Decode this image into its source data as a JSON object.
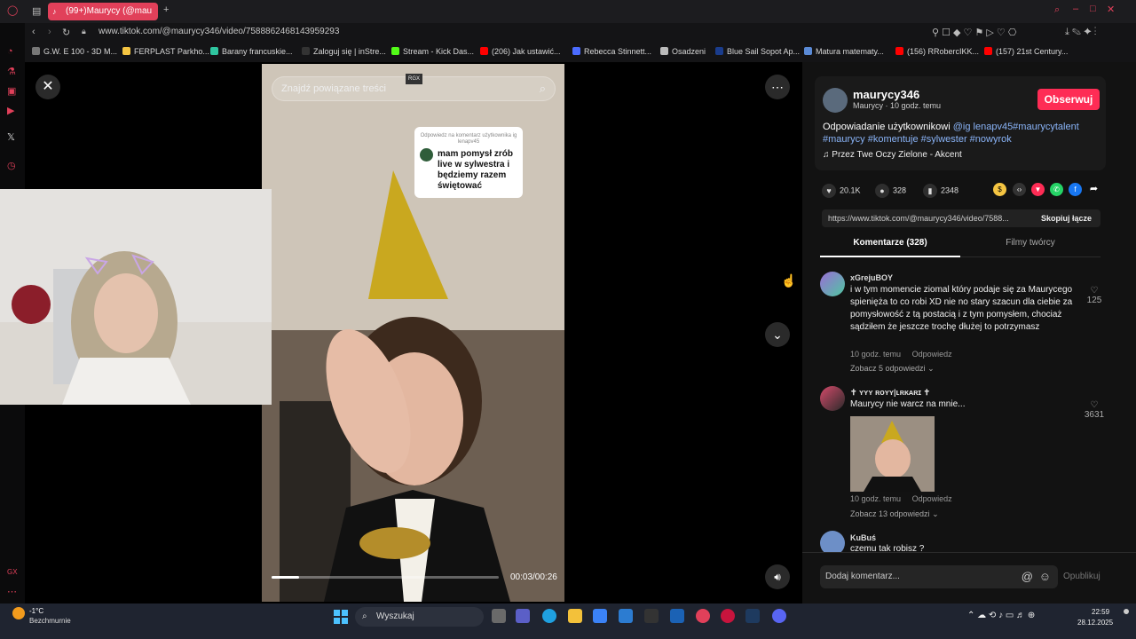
{
  "browser": {
    "tab_title": "(99+)Maurycy (@mau",
    "url": "www.tiktok.com/@maurycy346/video/7588862468143959293",
    "bookmarks": [
      {
        "label": "G.W. E 100 - 3D M...",
        "color": "#777777"
      },
      {
        "label": "FERPLAST Parkho...",
        "color": "#f5c542"
      },
      {
        "label": "Barany francuskie...",
        "color": "#2fc6a0"
      },
      {
        "label": "Zaloguj się | inStre...",
        "color": "#333333"
      },
      {
        "label": "Stream - Kick Das...",
        "color": "#53fc18"
      },
      {
        "label": "(206) Jak ustawić...",
        "color": "#ff0000"
      },
      {
        "label": "Rebecca Stinnett...",
        "color": "#4b6cff"
      },
      {
        "label": "Osadzeni",
        "color": "#bbbbbb"
      },
      {
        "label": "Blue Sail Sopot Ap...",
        "color": "#1a3c8c"
      },
      {
        "label": "Matura matematy...",
        "color": "#5a8ad6"
      },
      {
        "label": "(156) RRobercIKK...",
        "color": "#ff0000"
      },
      {
        "label": "(157) 21st Century...",
        "color": "#ff0000"
      }
    ]
  },
  "video": {
    "search_placeholder": "Znajdź powiązane treści",
    "search_badge": "RGX",
    "reply_card_header": "Odpowiedz na komentarz użytkownika ig lenapv45",
    "reply_card_text": "mam pomysł zrób live w sylwestra i będziemy razem świętować",
    "time": "00:03/00:26",
    "progress": 0.12
  },
  "author": {
    "handle": "maurycy346",
    "subtitle": "Maurycy · 10 godz. temu",
    "follow_label": "Obserwuj",
    "desc_prefix": "Odpowiadanie użytkownikowi",
    "desc_tags": "@ig lenapv45#maurycytalent #maurycy #komentuje #sylwester #nowyrok",
    "music": "Przez Twe Oczy Zielone - Akcent"
  },
  "stats": {
    "likes": "20.1K",
    "comments": "328",
    "saves": "2348"
  },
  "link": {
    "url": "https://www.tiktok.com/@maurycy346/video/7588...",
    "copy_label": "Skopiuj łącze"
  },
  "tabs": {
    "comments": "Komentarze (328)",
    "creator": "Filmy twórcy"
  },
  "comments": [
    {
      "user": "xGrejuBOY",
      "text": "i w tym momencie ziomal który podaje się za Maurycego spienięża to co robi XD nie no stary szacun dla ciebie za pomysłowość z tą postacią i z tym pomysłem, chociaż sądziłem że jeszcze trochę dłużej to potrzymasz",
      "time": "10 godz. temu",
      "reply": "Odpowiedz",
      "more": "Zobacz 5 odpowiedzi",
      "likes": "125"
    },
    {
      "user": "✝ ʏʏʏ ʀᴏʏʏ|ʟʀᴋᴀʀɪ ✝",
      "text": "Maurycy nie warcz na mnie...",
      "time": "10 godz. temu",
      "reply": "Odpowiedz",
      "more": "Zobacz 13 odpowiedzi",
      "likes": "3631"
    },
    {
      "user": "KuBuś",
      "text": "czemu tak robisz ?"
    }
  ],
  "comment_input": {
    "placeholder": "Dodaj komentarz...",
    "post_label": "Opublikuj"
  },
  "taskbar": {
    "weather_temp": "-1°C",
    "weather_text": "Bezchmurnie",
    "search": "Wyszukaj",
    "time": "22:59",
    "date": "28.12.2025"
  },
  "colors": {
    "accent": "#fe2c55",
    "link_blue": "#8ab4f8"
  }
}
